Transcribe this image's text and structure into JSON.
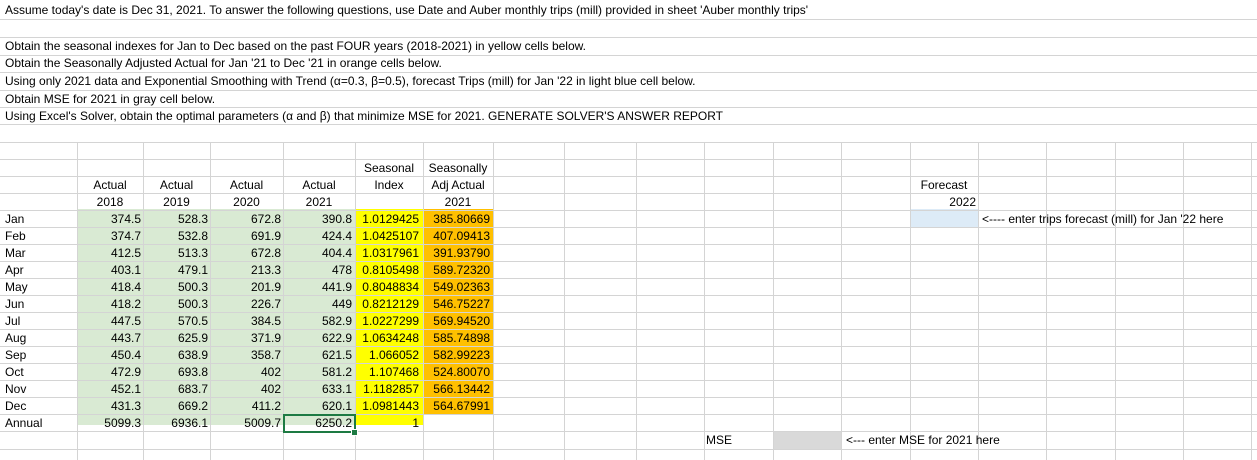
{
  "instructions": {
    "line1": "Assume today's date is Dec 31, 2021. To answer the following questions, use Date and Auber monthly trips (mill) provided in sheet 'Auber monthly trips'",
    "line2": "Obtain the seasonal indexes for Jan to Dec based on the past FOUR years (2018-2021) in yellow cells below.",
    "line3": "Obtain the Seasonally Adjusted Actual for Jan '21 to Dec '21 in orange cells below.",
    "line4": "Using only 2021 data and Exponential Smoothing with Trend (α=0.3, β=0.5), forecast Trips (mill) for Jan '22 in light blue cell below.",
    "line5": "Obtain MSE for 2021 in gray cell below.",
    "line6": "Using Excel's Solver, obtain the optimal parameters (α and β) that minimize MSE for 2021. GENERATE SOLVER'S ANSWER REPORT"
  },
  "headers": {
    "seasonal_top": "Seasonal",
    "seasonal_bottom": "Index",
    "adj_top": "Seasonally",
    "adj_mid": "Adj Actual",
    "adj_year": "2021",
    "actual": "Actual",
    "years": [
      "2018",
      "2019",
      "2020",
      "2021"
    ],
    "forecast": "Forecast",
    "forecast_year": "2022"
  },
  "rows": [
    {
      "month": "Jan",
      "a2018": "374.5",
      "a2019": "528.3",
      "a2020": "672.8",
      "a2021": "390.8",
      "si": "1.0129425",
      "adj": "385.80669"
    },
    {
      "month": "Feb",
      "a2018": "374.7",
      "a2019": "532.8",
      "a2020": "691.9",
      "a2021": "424.4",
      "si": "1.0425107",
      "adj": "407.09413"
    },
    {
      "month": "Mar",
      "a2018": "412.5",
      "a2019": "513.3",
      "a2020": "672.8",
      "a2021": "404.4",
      "si": "1.0317961",
      "adj": "391.93790"
    },
    {
      "month": "Apr",
      "a2018": "403.1",
      "a2019": "479.1",
      "a2020": "213.3",
      "a2021": "478",
      "si": "0.8105498",
      "adj": "589.72320"
    },
    {
      "month": "May",
      "a2018": "418.4",
      "a2019": "500.3",
      "a2020": "201.9",
      "a2021": "441.9",
      "si": "0.8048834",
      "adj": "549.02363"
    },
    {
      "month": "Jun",
      "a2018": "418.2",
      "a2019": "500.3",
      "a2020": "226.7",
      "a2021": "449",
      "si": "0.8212129",
      "adj": "546.75227"
    },
    {
      "month": "Jul",
      "a2018": "447.5",
      "a2019": "570.5",
      "a2020": "384.5",
      "a2021": "582.9",
      "si": "1.0227299",
      "adj": "569.94520"
    },
    {
      "month": "Aug",
      "a2018": "443.7",
      "a2019": "625.9",
      "a2020": "371.9",
      "a2021": "622.9",
      "si": "1.0634248",
      "adj": "585.74898"
    },
    {
      "month": "Sep",
      "a2018": "450.4",
      "a2019": "638.9",
      "a2020": "358.7",
      "a2021": "621.5",
      "si": "1.066052",
      "adj": "582.99223"
    },
    {
      "month": "Oct",
      "a2018": "472.9",
      "a2019": "693.8",
      "a2020": "402",
      "a2021": "581.2",
      "si": "1.107468",
      "adj": "524.80070"
    },
    {
      "month": "Nov",
      "a2018": "452.1",
      "a2019": "683.7",
      "a2020": "402",
      "a2021": "633.1",
      "si": "1.1182857",
      "adj": "566.13442"
    },
    {
      "month": "Dec",
      "a2018": "431.3",
      "a2019": "669.2",
      "a2020": "411.2",
      "a2021": "620.1",
      "si": "1.0981443",
      "adj": "564.67991"
    }
  ],
  "annual": {
    "label": "Annual",
    "a2018": "5099.3",
    "a2019": "6936.1",
    "a2020": "5009.7",
    "a2021": "6250.2",
    "si": "1"
  },
  "forecast_note": "<---- enter trips forecast (mill) for Jan '22 here",
  "mse_label": "MSE",
  "mse_note": "<--- enter MSE for 2021 here",
  "colors": {
    "green": "#d9ead3",
    "yellow": "#ffff00",
    "orange": "#ffc000",
    "blue": "#ddebf7",
    "gray": "#d9d9d9",
    "selection": "#1d7a43"
  }
}
